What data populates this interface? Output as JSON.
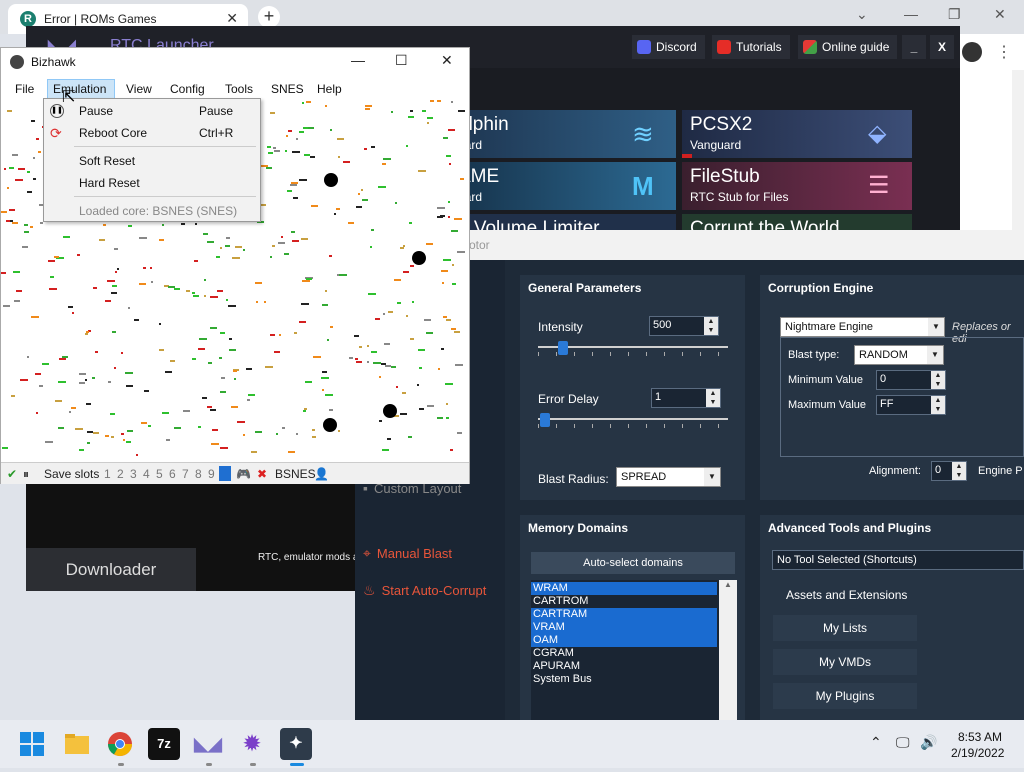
{
  "chrome": {
    "tab_title": "Error | ROMs Games",
    "tab_close": "✕",
    "new_tab": "+"
  },
  "launcher": {
    "title": "RTC Launcher",
    "discord": "Discord",
    "tutorials": "Tutorials",
    "online_guide": "Online guide",
    "minimize": "_",
    "close": "X",
    "cards": [
      {
        "name": "olphin",
        "sub": "uard"
      },
      {
        "name": "PCSX2",
        "sub": "Vanguard"
      },
      {
        "name": "AME",
        "sub": "uard"
      },
      {
        "name": "FileStub",
        "sub": "RTC Stub for Files"
      },
      {
        "name": "n Volume Limiter",
        "sub": ""
      },
      {
        "name": "Corrupt the World",
        "sub": ""
      }
    ],
    "downloader": "Downloader",
    "footer": "RTC, emulator mods a"
  },
  "rtc": {
    "title_fragment": "otor",
    "side_custom_layout": "Custom Layout",
    "side_manual_blast": "Manual Blast",
    "side_start_auto": "Start Auto-Corrupt",
    "general": {
      "header": "General Parameters",
      "intensity_label": "Intensity",
      "intensity_value": "500",
      "intensity_pct": 0.11,
      "error_delay_label": "Error Delay",
      "error_delay_value": "1",
      "error_delay_pct": 0.01,
      "blast_radius_label": "Blast Radius:",
      "blast_radius_value": "SPREAD"
    },
    "engine": {
      "header": "Corruption Engine",
      "engine_value": "Nightmare Engine",
      "replaces_note": "Replaces or edi",
      "blast_type_label": "Blast type:",
      "blast_type_value": "RANDOM",
      "min_label": "Minimum Value",
      "min_value": "0",
      "max_label": "Maximum Value",
      "max_value": "FF",
      "alignment_label": "Alignment:",
      "alignment_value": "0",
      "engine_p": "Engine P"
    },
    "memory": {
      "header": "Memory Domains",
      "auto_select": "Auto-select domains",
      "domains": [
        {
          "name": "WRAM",
          "selected": true
        },
        {
          "name": "CARTROM",
          "selected": false
        },
        {
          "name": "CARTRAM",
          "selected": true
        },
        {
          "name": "VRAM",
          "selected": true
        },
        {
          "name": "OAM",
          "selected": true
        },
        {
          "name": "CGRAM",
          "selected": false
        },
        {
          "name": "APURAM",
          "selected": false
        },
        {
          "name": "System Bus",
          "selected": false
        }
      ]
    },
    "advanced": {
      "header": "Advanced Tools and Plugins",
      "tool_select": "No Tool Selected (Shortcuts)",
      "assets_header": "Assets and Extensions",
      "my_lists": "My Lists",
      "my_vmds": "My VMDs",
      "my_plugins": "My Plugins"
    }
  },
  "bizhawk": {
    "title": "Bizhawk",
    "menu": [
      "File",
      "Emulation",
      "View",
      "Config",
      "Tools",
      "SNES",
      "Help"
    ],
    "status_save_slots": "Save slots",
    "slots": [
      "1",
      "2",
      "3",
      "4",
      "5",
      "6",
      "7",
      "8",
      "9"
    ],
    "core": "BSNES",
    "emu_menu": {
      "pause": "Pause",
      "pause_key": "Pause",
      "reboot": "Reboot Core",
      "reboot_key": "Ctrl+R",
      "soft_reset": "Soft Reset",
      "hard_reset": "Hard Reset",
      "loaded_core": "Loaded core: BSNES (SNES)"
    }
  },
  "taskbar": {
    "apps": [
      "start-icon",
      "file-explorer-icon",
      "chrome-icon",
      "7zip-icon",
      "rtc-launcher-icon",
      "bizhawk-icon",
      "rtc-icon"
    ],
    "time": "8:53 AM",
    "date": "2/19/2022"
  }
}
